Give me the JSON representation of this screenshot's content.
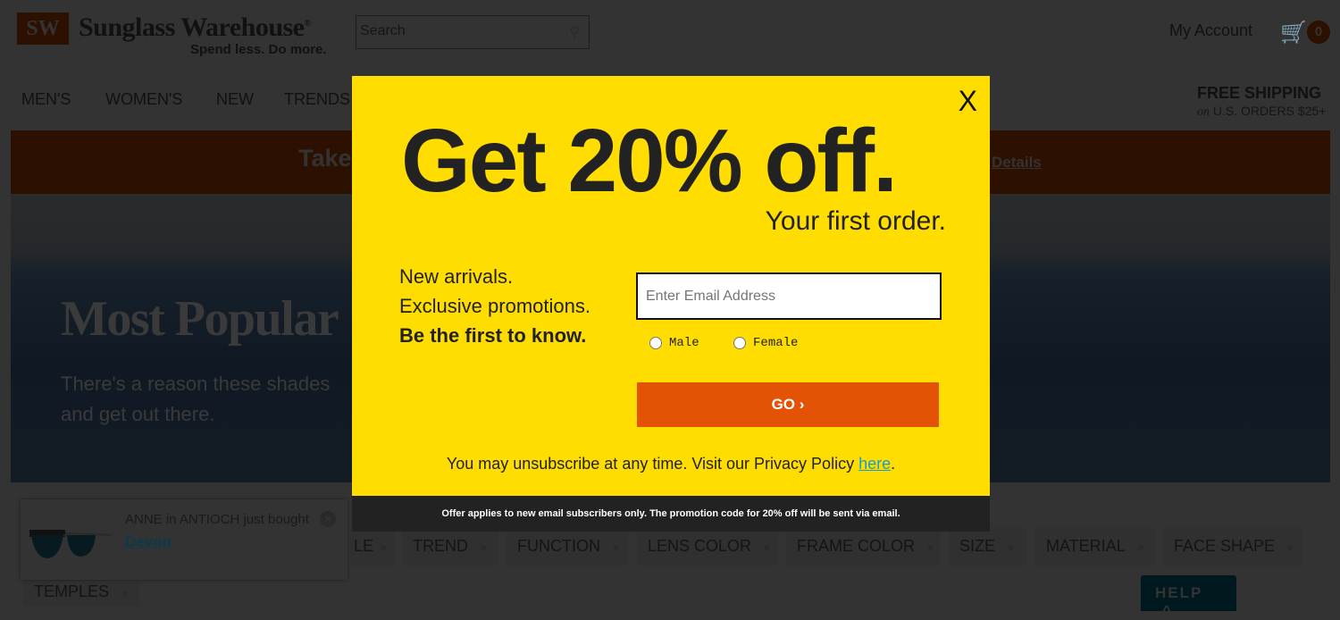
{
  "header": {
    "logo_mark": "SW",
    "brand": "Sunglass Warehouse",
    "registered": "®",
    "tagline": "Spend less. Do more.",
    "search_placeholder": "Search",
    "account": "My Account",
    "cart_count": "0"
  },
  "nav": [
    "MEN'S",
    "WOMEN'S",
    "NEW",
    "TRENDS"
  ],
  "shipping": {
    "title": "FREE SHIPPING",
    "on": "on",
    "detail": "U.S. ORDERS $25+"
  },
  "banner": {
    "text": "Take",
    "details": "Details"
  },
  "hero": {
    "title": "Most Popular",
    "line1": "There's a reason these shades",
    "line2": "and get out there."
  },
  "filters": [
    "LE",
    "TREND",
    "FUNCTION",
    "LENS COLOR",
    "FRAME COLOR",
    "SIZE",
    "MATERIAL",
    "FACE SHAPE",
    "TEMPLES"
  ],
  "toast": {
    "who": "ANNE in ANTIOCH just bought",
    "product": "Devon"
  },
  "help": "HELP",
  "modal": {
    "close": "X",
    "headline": "Get 20% off.",
    "sub": "Your first order.",
    "pitch1": "New arrivals.",
    "pitch2": "Exclusive promotions.",
    "pitch3": "Be the first to know.",
    "email_placeholder": "Enter Email Address",
    "male": "Male",
    "female": "Female",
    "go": "GO ›",
    "unsub": "You may unsubscribe at any time. Visit our Privacy Policy ",
    "here": "here",
    "period": ".",
    "disclaimer": "Offer applies to new email subscribers only. The promotion code for 20% off will be sent via email."
  },
  "colors": {
    "brand_orange": "#e25a0c",
    "popup_yellow": "#ffdd00",
    "go_button": "#e35205",
    "help_teal": "#0c5a6b"
  }
}
